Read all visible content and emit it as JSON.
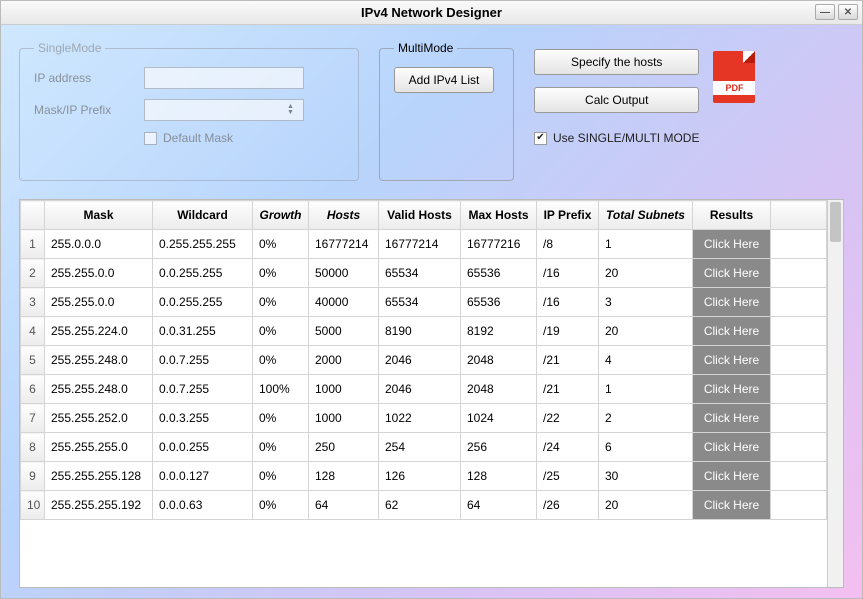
{
  "window": {
    "title": "IPv4 Network Designer"
  },
  "single": {
    "legend": "SingleMode",
    "ip_label": "IP address",
    "mask_label": "Mask/IP Prefix",
    "default_mask_label": "Default Mask",
    "ip_value": "",
    "mask_value": ""
  },
  "multi": {
    "legend": "MultiMode",
    "add_list_label": "Add IPv4 List"
  },
  "actions": {
    "specify_hosts": "Specify the hosts",
    "calc_output": "Calc Output",
    "pdf_label": "PDF"
  },
  "mode_checkbox": {
    "checked": true,
    "label": "Use SINGLE/MULTI  MODE"
  },
  "table": {
    "headers": {
      "mask": "Mask",
      "wildcard": "Wildcard",
      "growth": "Growth",
      "hosts": "Hosts",
      "valid_hosts": "Valid Hosts",
      "max_hosts": "Max Hosts",
      "ip_prefix": "IP Prefix",
      "total_subnets": "Total Subnets",
      "results": "Results"
    },
    "click_label": "Click Here",
    "rows": [
      {
        "n": "1",
        "mask": "255.0.0.0",
        "wildcard": "0.255.255.255",
        "growth": "0%",
        "hosts": "16777214",
        "valid": "16777214",
        "max": "16777216",
        "prefix": "/8",
        "subnets": "1"
      },
      {
        "n": "2",
        "mask": "255.255.0.0",
        "wildcard": "0.0.255.255",
        "growth": "0%",
        "hosts": "50000",
        "valid": "65534",
        "max": "65536",
        "prefix": "/16",
        "subnets": "20"
      },
      {
        "n": "3",
        "mask": "255.255.0.0",
        "wildcard": "0.0.255.255",
        "growth": "0%",
        "hosts": "40000",
        "valid": "65534",
        "max": "65536",
        "prefix": "/16",
        "subnets": "3"
      },
      {
        "n": "4",
        "mask": "255.255.224.0",
        "wildcard": "0.0.31.255",
        "growth": "0%",
        "hosts": "5000",
        "valid": "8190",
        "max": "8192",
        "prefix": "/19",
        "subnets": "20"
      },
      {
        "n": "5",
        "mask": "255.255.248.0",
        "wildcard": "0.0.7.255",
        "growth": "0%",
        "hosts": "2000",
        "valid": "2046",
        "max": "2048",
        "prefix": "/21",
        "subnets": "4"
      },
      {
        "n": "6",
        "mask": "255.255.248.0",
        "wildcard": "0.0.7.255",
        "growth": "100%",
        "hosts": "1000",
        "valid": "2046",
        "max": "2048",
        "prefix": "/21",
        "subnets": "1"
      },
      {
        "n": "7",
        "mask": "255.255.252.0",
        "wildcard": "0.0.3.255",
        "growth": "0%",
        "hosts": "1000",
        "valid": "1022",
        "max": "1024",
        "prefix": "/22",
        "subnets": "2"
      },
      {
        "n": "8",
        "mask": "255.255.255.0",
        "wildcard": "0.0.0.255",
        "growth": "0%",
        "hosts": "250",
        "valid": "254",
        "max": "256",
        "prefix": "/24",
        "subnets": "6"
      },
      {
        "n": "9",
        "mask": "255.255.255.128",
        "wildcard": "0.0.0.127",
        "growth": "0%",
        "hosts": "128",
        "valid": "126",
        "max": "128",
        "prefix": "/25",
        "subnets": "30"
      },
      {
        "n": "10",
        "mask": "255.255.255.192",
        "wildcard": "0.0.0.63",
        "growth": "0%",
        "hosts": "64",
        "valid": "62",
        "max": "64",
        "prefix": "/26",
        "subnets": "20"
      }
    ]
  }
}
